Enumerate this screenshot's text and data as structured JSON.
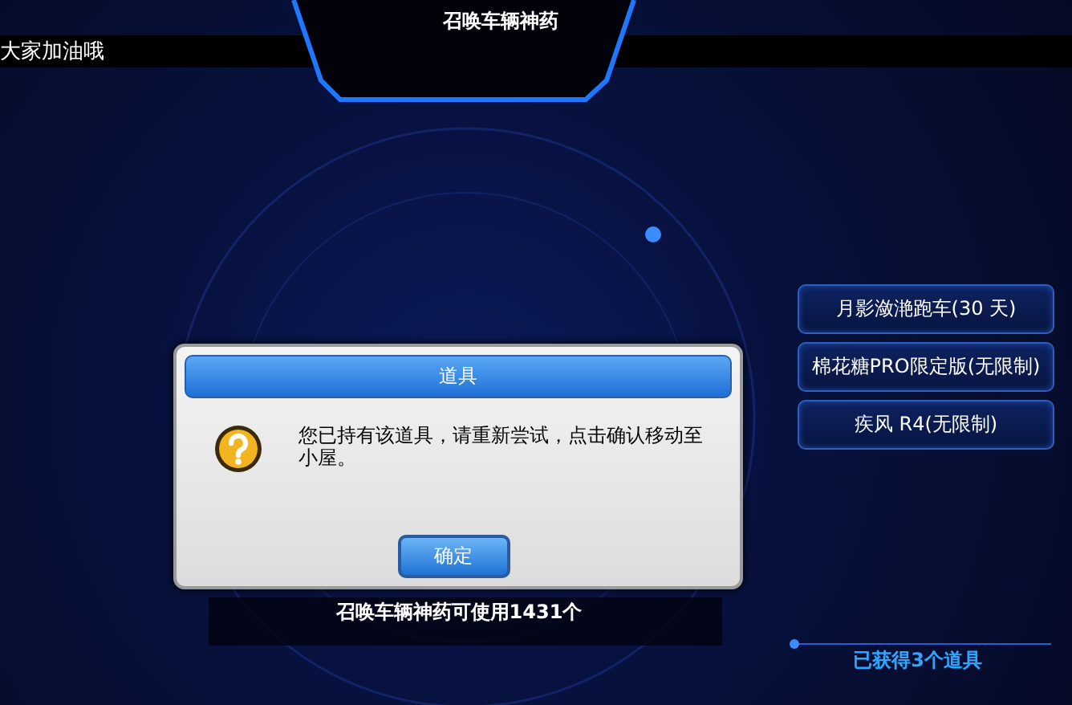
{
  "header": {
    "title": "召唤车辆神药",
    "banner": "大家加油哦"
  },
  "items": [
    {
      "label": "月影潋滟跑车(30 天)"
    },
    {
      "label": "棉花糖PRO限定版(无限制)"
    },
    {
      "label": "疾风 R4(无限制)"
    }
  ],
  "usage": "召唤车辆神药可使用1431个",
  "obtained": "已获得3个道具",
  "dialog": {
    "title": "道具",
    "message": "您已持有该道具，请重新尝试，点击确认移动至小屋。",
    "button": "确定"
  }
}
